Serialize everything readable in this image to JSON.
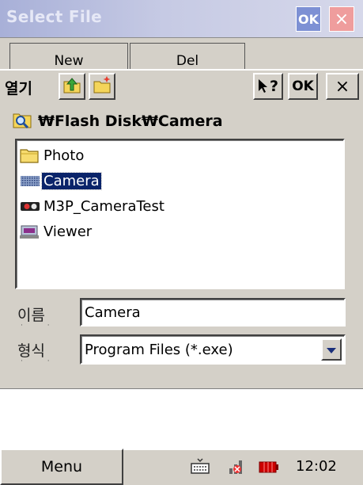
{
  "window": {
    "title": "Select File",
    "ok_label": "OK",
    "close_label": "×"
  },
  "background_tabs": {
    "new_label": "New",
    "del_label": "Del"
  },
  "dialog": {
    "open_label": "열기",
    "toolbar": {
      "up_icon": "up-folder-icon",
      "new_folder_icon": "new-folder-icon",
      "help_label": "?",
      "ok_label": "OK",
      "close_label": "×"
    },
    "current_path": "₩Flash Disk₩Camera",
    "items": [
      {
        "label": "Photo",
        "icon": "folder-icon",
        "selected": false
      },
      {
        "label": "Camera",
        "icon": "camera-app-icon",
        "selected": true
      },
      {
        "label": "M3P_CameraTest",
        "icon": "camera-test-icon",
        "selected": false
      },
      {
        "label": "Viewer",
        "icon": "viewer-app-icon",
        "selected": false
      }
    ],
    "name_label": "이름",
    "name_value": "Camera",
    "type_label": "형식",
    "type_value": "Program Files (*.exe)"
  },
  "taskbar": {
    "menu_label": "Menu",
    "time": "12:02"
  },
  "colors": {
    "selection": "#0a246a",
    "face": "#d4d0c8",
    "title_ok": "#7d90d4",
    "title_close": "#ef9d9d"
  }
}
